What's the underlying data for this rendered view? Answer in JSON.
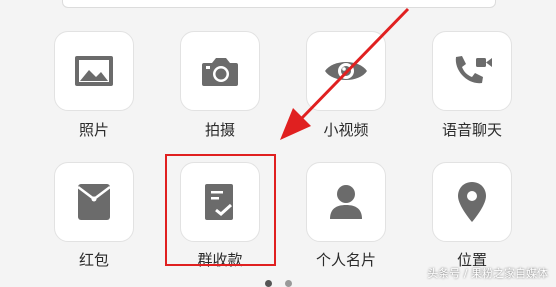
{
  "panel": {
    "items": [
      {
        "label": "照片",
        "icon": "photo-icon"
      },
      {
        "label": "拍摄",
        "icon": "camera-icon"
      },
      {
        "label": "小视频",
        "icon": "eye-icon"
      },
      {
        "label": "语音聊天",
        "icon": "voice-call-icon"
      },
      {
        "label": "红包",
        "icon": "red-packet-icon"
      },
      {
        "label": "群收款",
        "icon": "group-collection-icon"
      },
      {
        "label": "个人名片",
        "icon": "contact-card-icon"
      },
      {
        "label": "位置",
        "icon": "location-icon"
      }
    ]
  },
  "watermark": "头条号 / 果粉之家自媒体",
  "colors": {
    "annotation": "#e02020",
    "icon": "#6b6b6b",
    "background": "#f4f4f4"
  }
}
